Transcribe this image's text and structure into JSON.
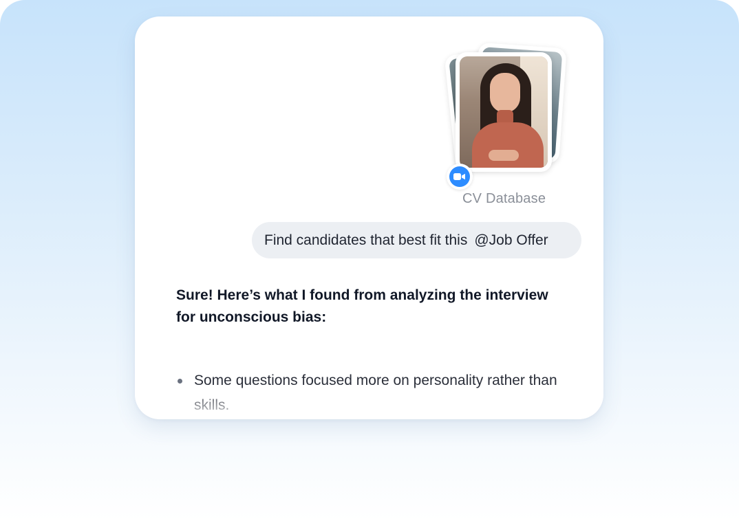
{
  "attachment": {
    "label": "CV Database",
    "badge_icon": "video-camera-icon",
    "badge_color": "#2d8cff"
  },
  "user_message": {
    "text": "Find candidates that best fit this",
    "mention": "@Job Offer"
  },
  "assistant_message": {
    "heading": "Sure! Here’s what I found from analyzing the interview for unconscious bias:",
    "bullets": [
      "Some questions focused more on personality rather than skills."
    ]
  },
  "colors": {
    "background_top": "#c7e3fb",
    "bubble": "#eceff3",
    "accent": "#2d8cff"
  }
}
